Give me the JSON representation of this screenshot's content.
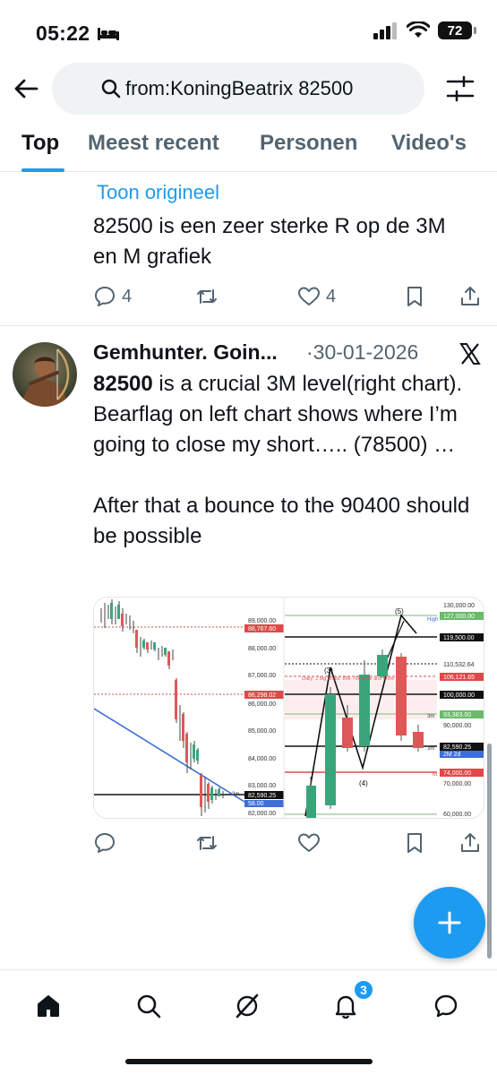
{
  "status_bar": {
    "time": "05:22",
    "battery": "72"
  },
  "search": {
    "query": "from:KoningBeatrix 82500"
  },
  "tabs": [
    {
      "label": "Top",
      "active": true
    },
    {
      "label": "Meest recent",
      "active": false
    },
    {
      "label": "Personen",
      "active": false
    },
    {
      "label": "Video's",
      "active": false
    }
  ],
  "tweet1": {
    "show_original": "Toon origineel",
    "text": "82500 is een zeer sterke R op de 3M en M grafiek",
    "replies": "4",
    "likes": "4"
  },
  "tweet2": {
    "author": "Gemhunter. Goin...",
    "separator": "·",
    "date": "30-01-2026",
    "text_bold": "82500",
    "text_rest": " is a crucial 3M level(right chart). Bearflag on left chart shows where I’m going to close my short….. (78500) …",
    "text_para2": "After that a bounce to the 90400 should be possible"
  },
  "chart_left": {
    "price_labels": [
      "89,000.00",
      "88,767.60",
      "88,000.00",
      "87,000.00",
      "86,298.02",
      "86,000.00",
      "85,000.00",
      "84,000.00",
      "83,000.00",
      "82,590.25",
      "82,000.00"
    ],
    "marker_3m": "3m",
    "extra_label": "58.00"
  },
  "chart_right": {
    "price_labels": [
      "130,000.00",
      "127,000.00",
      "119,500.00",
      "110,532.64",
      "106,121.65",
      "100,000.00",
      "93,383.00",
      "90,000.00",
      "82,590.25",
      "74,000.00",
      "70,000.00",
      "60,000.00"
    ],
    "wave_labels": [
      "(3)",
      "(4)",
      "(5)"
    ],
    "label_high": "High",
    "label_3m_a": "3m",
    "label_3m_b": "3m",
    "label_2m": "2M 2d",
    "label_m": "M",
    "annotation": "Daily: 2 big drops: 86k-76k Here and More"
  },
  "nav": {
    "notifications_badge": "3"
  }
}
